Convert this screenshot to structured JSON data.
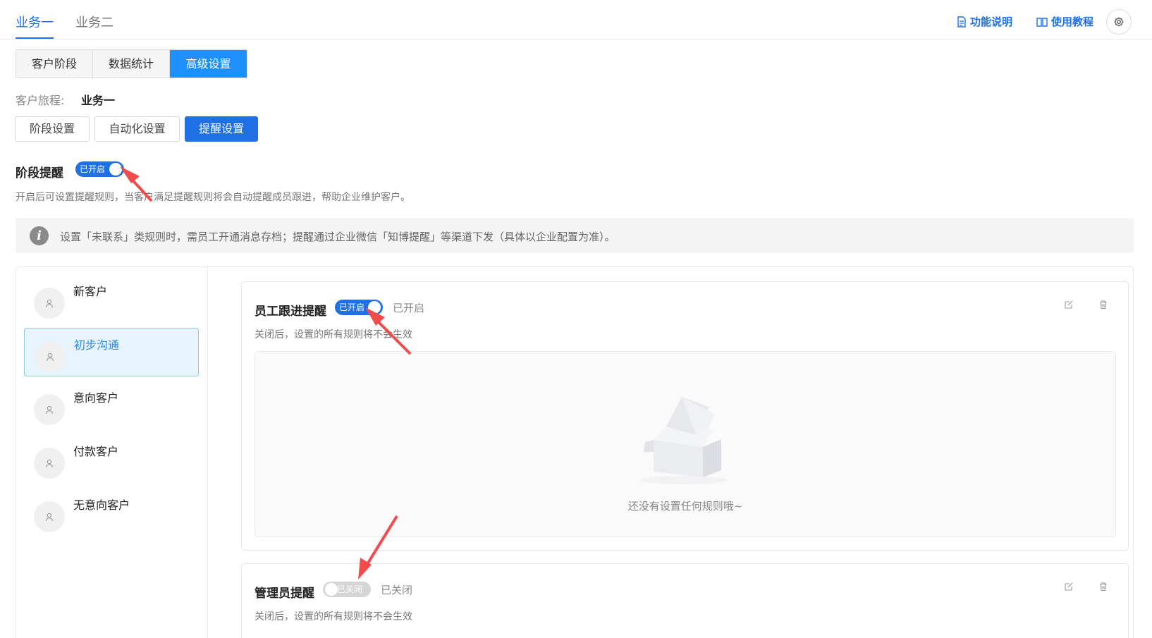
{
  "top_tabs": [
    {
      "label": "业务一",
      "active": true
    },
    {
      "label": "业务二",
      "active": false
    }
  ],
  "top_links": {
    "feature_description": "功能说明",
    "tutorial": "使用教程"
  },
  "main_tabs": [
    {
      "label": "客户阶段",
      "active": false
    },
    {
      "label": "数据统计",
      "active": false
    },
    {
      "label": "高级设置",
      "active": true
    }
  ],
  "journey": {
    "label": "客户旅程:",
    "value": "业务一"
  },
  "sub_tabs": [
    {
      "label": "阶段设置",
      "active": false
    },
    {
      "label": "自动化设置",
      "active": false
    },
    {
      "label": "提醒设置",
      "active": true
    }
  ],
  "stage_reminder": {
    "title": "阶段提醒",
    "switch_text": "已开启",
    "enabled": true,
    "description": "开启后可设置提醒规则，当客户满足提醒规则将会自动提醒成员跟进，帮助企业维护客户。"
  },
  "notice": {
    "icon": "info-icon",
    "text": "设置「未联系」类规则时，需员工开通消息存档；提醒通过企业微信「知博提醒」等渠道下发（具体以企业配置为准）。"
  },
  "stages": [
    {
      "label": "新客户",
      "active": false
    },
    {
      "label": "初步沟通",
      "active": true
    },
    {
      "label": "意向客户",
      "active": false
    },
    {
      "label": "付款客户",
      "active": false
    },
    {
      "label": "无意向客户",
      "active": false
    }
  ],
  "cards": {
    "employee": {
      "title": "员工跟进提醒",
      "switch_text": "已开启",
      "status": "已开启",
      "enabled": true,
      "description": "关闭后，设置的所有规则将不会生效",
      "empty_text": "还没有设置任何规则哦~"
    },
    "admin": {
      "title": "管理员提醒",
      "switch_text": "已关闭",
      "status": "已关闭",
      "enabled": false,
      "description": "关闭后，设置的所有规则将不会生效"
    }
  },
  "colors": {
    "primary": "#1f6fe5",
    "segment_active": "#1e8fff",
    "annotation_arrow": "#f24b4b"
  }
}
